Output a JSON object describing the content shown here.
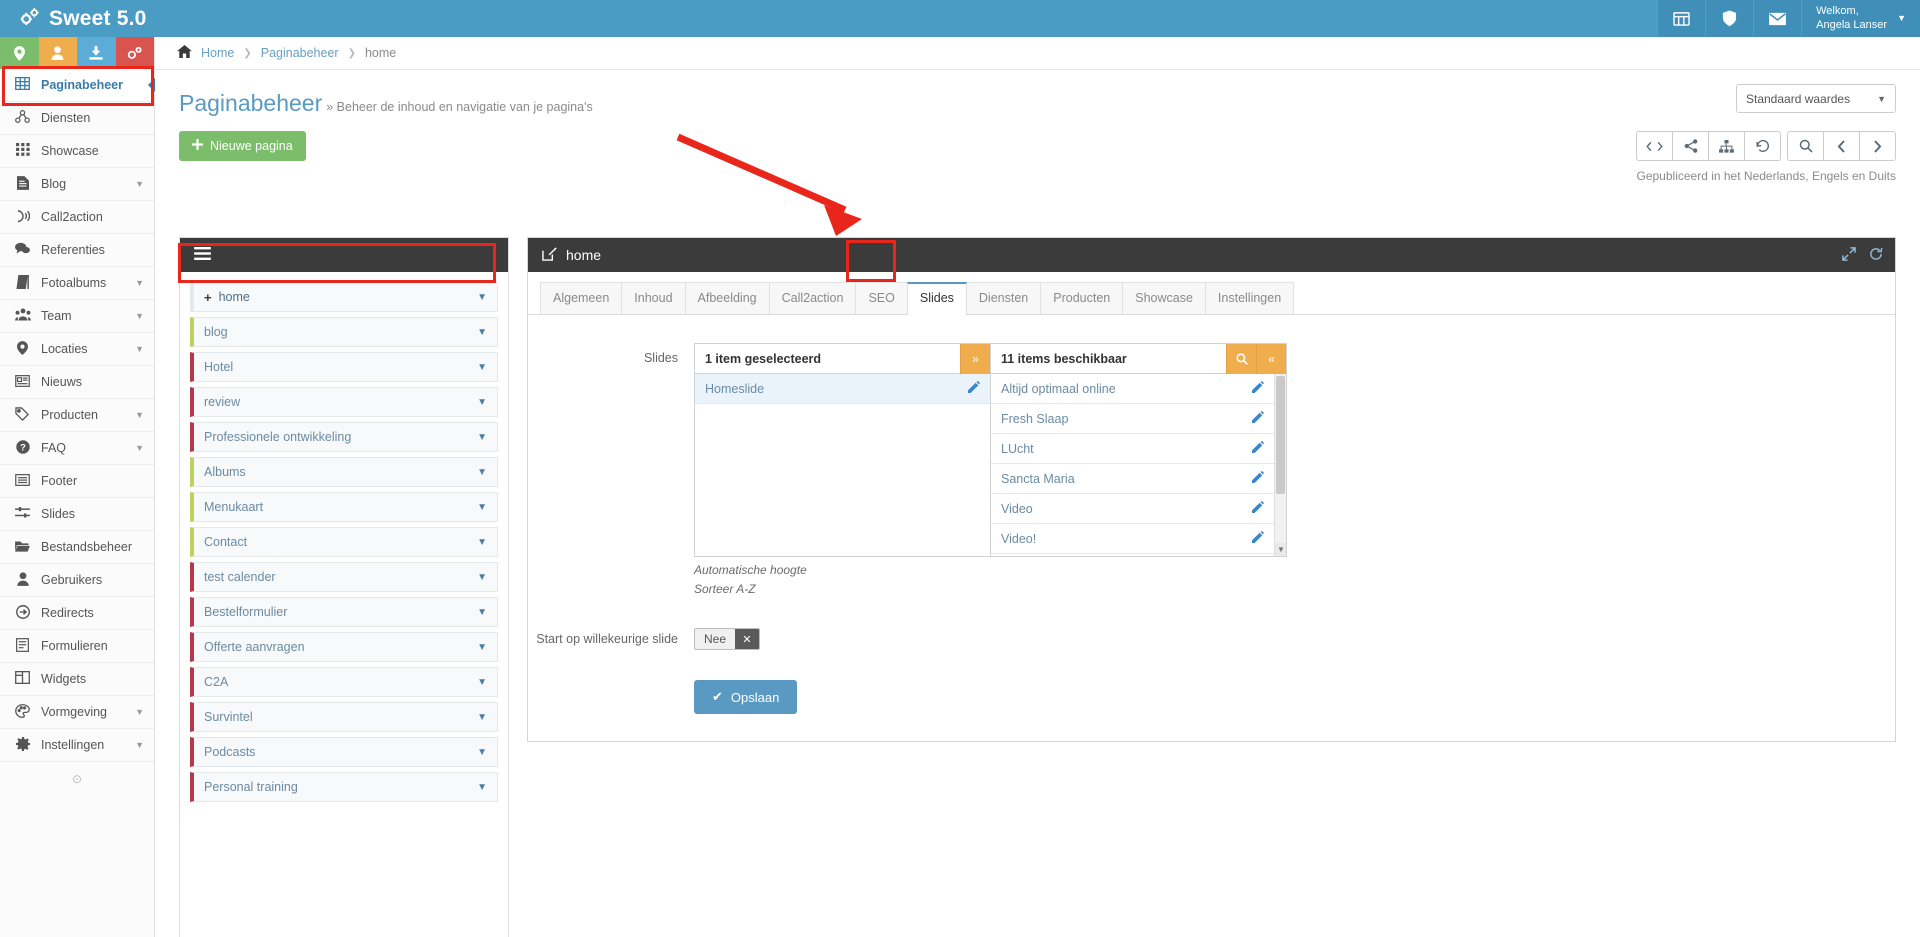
{
  "topbar": {
    "brand": "Sweet 5.0",
    "brand_icon": "gears-icon",
    "buttons": [
      {
        "name": "calendar-icon",
        "glyph": "▦"
      },
      {
        "name": "shield-icon",
        "glyph": "⬟"
      },
      {
        "name": "mail-icon",
        "glyph": "✉"
      }
    ],
    "user_greeting": "Welkom,",
    "user_name": "Angela Lanser",
    "user_caret": "▼"
  },
  "quick_actions": [
    {
      "name": "location-pin-icon",
      "glyph": "●",
      "color": "#7bbd6a"
    },
    {
      "name": "user-icon",
      "glyph": "●",
      "color": "#f0ad4e"
    },
    {
      "name": "download-icon",
      "glyph": "●",
      "color": "#5bacd6"
    },
    {
      "name": "gears-icon",
      "glyph": "●",
      "color": "#d9534f"
    }
  ],
  "sidebar": {
    "items": [
      {
        "label": "Paginabeheer",
        "icon": "table-icon",
        "active": true,
        "chevron": false
      },
      {
        "label": "Diensten",
        "icon": "sitemap-icon",
        "active": false,
        "chevron": false
      },
      {
        "label": "Showcase",
        "icon": "grid-icon",
        "active": false,
        "chevron": false
      },
      {
        "label": "Blog",
        "icon": "file-text-icon",
        "active": false,
        "chevron": true
      },
      {
        "label": "Call2action",
        "icon": "phone-volume-icon",
        "active": false,
        "chevron": false
      },
      {
        "label": "Referenties",
        "icon": "comments-icon",
        "active": false,
        "chevron": false
      },
      {
        "label": "Fotoalbums",
        "icon": "book-icon",
        "active": false,
        "chevron": true
      },
      {
        "label": "Team",
        "icon": "users-icon",
        "active": false,
        "chevron": true
      },
      {
        "label": "Locaties",
        "icon": "map-marker-icon",
        "active": false,
        "chevron": true
      },
      {
        "label": "Nieuws",
        "icon": "newspaper-icon",
        "active": false,
        "chevron": false
      },
      {
        "label": "Producten",
        "icon": "tags-icon",
        "active": false,
        "chevron": true
      },
      {
        "label": "FAQ",
        "icon": "question-circle-icon",
        "active": false,
        "chevron": true
      },
      {
        "label": "Footer",
        "icon": "list-alt-icon",
        "active": false,
        "chevron": false
      },
      {
        "label": "Slides",
        "icon": "sliders-icon",
        "active": false,
        "chevron": false
      },
      {
        "label": "Bestandsbeheer",
        "icon": "folder-open-icon",
        "active": false,
        "chevron": false
      },
      {
        "label": "Gebruikers",
        "icon": "user-icon",
        "active": false,
        "chevron": false
      },
      {
        "label": "Redirects",
        "icon": "arrow-circle-right-icon",
        "active": false,
        "chevron": false
      },
      {
        "label": "Formulieren",
        "icon": "form-icon",
        "active": false,
        "chevron": false
      },
      {
        "label": "Widgets",
        "icon": "columns-icon",
        "active": false,
        "chevron": false
      },
      {
        "label": "Vormgeving",
        "icon": "palette-icon",
        "active": false,
        "chevron": true
      },
      {
        "label": "Instellingen",
        "icon": "cog-icon",
        "active": false,
        "chevron": true
      }
    ],
    "footer_glyph": "⊙"
  },
  "breadcrumb": {
    "home_icon": "home-icon",
    "items": [
      "Home",
      "Paginabeheer",
      "home"
    ],
    "separator": "❯"
  },
  "page": {
    "title": "Paginabeheer",
    "subtitle": "» Beheer de inhoud en navigatie van je pagina's",
    "standard_select": "Standaard waardes",
    "standard_select_caret": "▼",
    "new_page_button": "Nieuwe pagina",
    "new_page_icon": "plus-icon",
    "publish_note": "Gepubliceerd in het Nederlands, Engels en Duits",
    "toolbar_icons": [
      {
        "name": "code-icon",
        "glyph": "‹›"
      },
      {
        "name": "share-icon",
        "glyph": "⍰"
      },
      {
        "name": "sitemap-icon",
        "glyph": "⑂"
      },
      {
        "name": "history-icon",
        "glyph": "↺"
      },
      {
        "name": "search-icon",
        "glyph": "⚲"
      },
      {
        "name": "prev-icon",
        "glyph": "‹"
      },
      {
        "name": "next-icon",
        "glyph": "›"
      }
    ]
  },
  "tree": {
    "menu_icon": "hamburger-icon",
    "rows": [
      {
        "label": "home",
        "color": "#e4e9ec",
        "root": true,
        "plus": "➕"
      },
      {
        "label": "blog",
        "color": "#bfd35a"
      },
      {
        "label": "Hotel",
        "color": "#b5394a"
      },
      {
        "label": "review",
        "color": "#b5394a"
      },
      {
        "label": "Professionele ontwikkeling",
        "color": "#b5394a"
      },
      {
        "label": "Albums",
        "color": "#bfd35a"
      },
      {
        "label": "Menukaart",
        "color": "#bfd35a"
      },
      {
        "label": "Contact",
        "color": "#bfd35a"
      },
      {
        "label": "test calender",
        "color": "#b5394a"
      },
      {
        "label": "Bestelformulier",
        "color": "#b5394a"
      },
      {
        "label": "Offerte aanvragen",
        "color": "#b5394a"
      },
      {
        "label": "C2A",
        "color": "#b5394a"
      },
      {
        "label": "Survintel",
        "color": "#b5394a"
      },
      {
        "label": "Podcasts",
        "color": "#b5394a"
      },
      {
        "label": "Personal training",
        "color": "#b5394a"
      }
    ],
    "caret": "▼"
  },
  "editor": {
    "title": "home",
    "title_icon": "edit-icon",
    "header_actions": [
      {
        "name": "expand-icon",
        "glyph": "⤡"
      },
      {
        "name": "refresh-icon",
        "glyph": "⟳"
      }
    ],
    "tabs": [
      {
        "label": "Algemeen",
        "active": false
      },
      {
        "label": "Inhoud",
        "active": false
      },
      {
        "label": "Afbeelding",
        "active": false
      },
      {
        "label": "Call2action",
        "active": false
      },
      {
        "label": "SEO",
        "active": false
      },
      {
        "label": "Slides",
        "active": true
      },
      {
        "label": "Diensten",
        "active": false
      },
      {
        "label": "Producten",
        "active": false
      },
      {
        "label": "Showcase",
        "active": false
      },
      {
        "label": "Instellingen",
        "active": false
      }
    ],
    "slides_field": {
      "label": "Slides",
      "selected_header": "1 item geselecteerd",
      "selected_action_icon": "chevron-double-right-icon",
      "selected_action_glyph": "»",
      "selected_items": [
        {
          "label": "Homeslide",
          "selected": true
        }
      ],
      "available_header": "11 items beschikbaar",
      "available_actions": [
        {
          "name": "search-icon",
          "glyph": "⚲"
        },
        {
          "name": "chevron-double-left-icon",
          "glyph": "«"
        }
      ],
      "available_items": [
        {
          "label": "Altijd optimaal online"
        },
        {
          "label": "Fresh Slaap"
        },
        {
          "label": "LUcht"
        },
        {
          "label": "Sancta Maria"
        },
        {
          "label": "Video"
        },
        {
          "label": "Video!"
        }
      ],
      "hints": [
        "Automatische hoogte",
        "Sorteer A-Z"
      ]
    },
    "random_slide": {
      "label": "Start op willekeurige slide",
      "value": "Nee",
      "clear_glyph": "✕"
    },
    "save_button": "Opslaan",
    "save_icon": "check-icon",
    "save_glyph": "✔"
  },
  "colors": {
    "brand_blue": "#4a9cc4",
    "accent_orange": "#f0ad4e",
    "accent_green": "#7bbd6a",
    "annotation_red": "#e8261b",
    "dark_panel": "#3b3b3b"
  }
}
